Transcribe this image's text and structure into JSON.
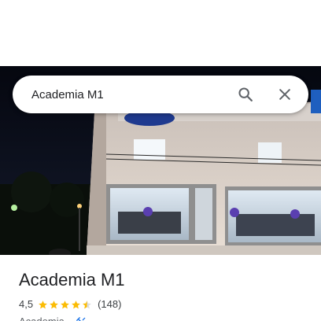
{
  "search": {
    "value": "Academia M1",
    "placeholder": "Academia M1"
  },
  "place": {
    "title": "Academia M1",
    "rating": "4,5",
    "rating_fraction": 0.9,
    "star_count": 5,
    "reviews": "(148)",
    "category": "Academia",
    "separator": "·",
    "category_icon": "dumbbell-icon"
  },
  "colors": {
    "star": "#FBBC04",
    "star_empty": "#dadce0",
    "icon": "#5f6368",
    "accent": "#1a73e8"
  }
}
